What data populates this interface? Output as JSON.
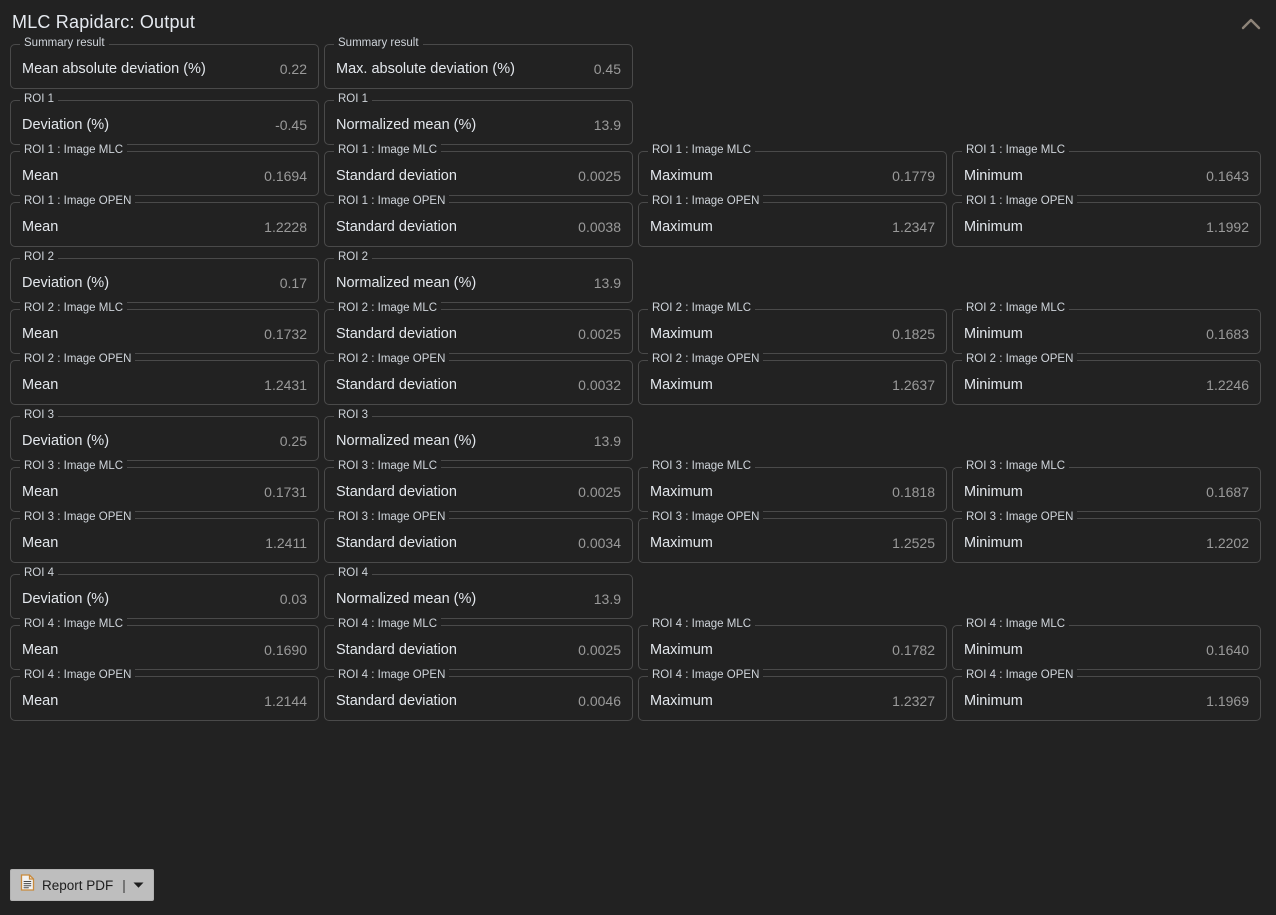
{
  "header": {
    "title": "MLC Rapidarc: Output",
    "collapse_icon": "chevron-up-icon"
  },
  "footer": {
    "report_button_label": "Report PDF",
    "report_button_icon": "document-icon",
    "separator": "|",
    "dropdown_icon": "caret-down-icon"
  },
  "colors": {
    "background": "#222222",
    "card_border": "#4a4a4a",
    "label_text": "#e3e7ec",
    "value_text": "#9a9a9a",
    "legend_text": "#cfd4da",
    "button_face": "#bebebe",
    "button_text": "#1d1d1d",
    "accent_icon": "#c98a3c"
  },
  "rows": [
    {
      "gap": true,
      "cells": [
        {
          "legend": "Summary result",
          "label": "Mean absolute deviation (%)",
          "value": "0.22"
        },
        {
          "legend": "Summary result",
          "label": "Max. absolute deviation (%)",
          "value": "0.45"
        },
        null,
        null
      ]
    },
    {
      "gap": false,
      "cells": [
        {
          "legend": "ROI 1",
          "label": "Deviation (%)",
          "value": "-0.45"
        },
        {
          "legend": "ROI 1",
          "label": "Normalized mean (%)",
          "value": "13.9"
        },
        null,
        null
      ]
    },
    {
      "gap": false,
      "cells": [
        {
          "legend": "ROI 1 : Image MLC",
          "label": "Mean",
          "value": "0.1694"
        },
        {
          "legend": "ROI 1 : Image MLC",
          "label": "Standard deviation",
          "value": "0.0025"
        },
        {
          "legend": "ROI 1 : Image MLC",
          "label": "Maximum",
          "value": "0.1779"
        },
        {
          "legend": "ROI 1 : Image MLC",
          "label": "Minimum",
          "value": "0.1643"
        }
      ]
    },
    {
      "gap": true,
      "cells": [
        {
          "legend": "ROI 1 : Image OPEN",
          "label": "Mean",
          "value": "1.2228"
        },
        {
          "legend": "ROI 1 : Image OPEN",
          "label": "Standard deviation",
          "value": "0.0038"
        },
        {
          "legend": "ROI 1 : Image OPEN",
          "label": "Maximum",
          "value": "1.2347"
        },
        {
          "legend": "ROI 1 : Image OPEN",
          "label": "Minimum",
          "value": "1.1992"
        }
      ]
    },
    {
      "gap": false,
      "cells": [
        {
          "legend": "ROI 2",
          "label": "Deviation (%)",
          "value": "0.17"
        },
        {
          "legend": "ROI 2",
          "label": "Normalized mean (%)",
          "value": "13.9"
        },
        null,
        null
      ]
    },
    {
      "gap": false,
      "cells": [
        {
          "legend": "ROI 2 : Image MLC",
          "label": "Mean",
          "value": "0.1732"
        },
        {
          "legend": "ROI 2 : Image MLC",
          "label": "Standard deviation",
          "value": "0.0025"
        },
        {
          "legend": "ROI 2 : Image MLC",
          "label": "Maximum",
          "value": "0.1825"
        },
        {
          "legend": "ROI 2 : Image MLC",
          "label": "Minimum",
          "value": "0.1683"
        }
      ]
    },
    {
      "gap": true,
      "cells": [
        {
          "legend": "ROI 2 : Image OPEN",
          "label": "Mean",
          "value": "1.2431"
        },
        {
          "legend": "ROI 2 : Image OPEN",
          "label": "Standard deviation",
          "value": "0.0032"
        },
        {
          "legend": "ROI 2 : Image OPEN",
          "label": "Maximum",
          "value": "1.2637"
        },
        {
          "legend": "ROI 2 : Image OPEN",
          "label": "Minimum",
          "value": "1.2246"
        }
      ]
    },
    {
      "gap": false,
      "cells": [
        {
          "legend": "ROI 3",
          "label": "Deviation (%)",
          "value": "0.25"
        },
        {
          "legend": "ROI 3",
          "label": "Normalized mean (%)",
          "value": "13.9"
        },
        null,
        null
      ]
    },
    {
      "gap": false,
      "cells": [
        {
          "legend": "ROI 3 : Image MLC",
          "label": "Mean",
          "value": "0.1731"
        },
        {
          "legend": "ROI 3 : Image MLC",
          "label": "Standard deviation",
          "value": "0.0025"
        },
        {
          "legend": "ROI 3 : Image MLC",
          "label": "Maximum",
          "value": "0.1818"
        },
        {
          "legend": "ROI 3 : Image MLC",
          "label": "Minimum",
          "value": "0.1687"
        }
      ]
    },
    {
      "gap": true,
      "cells": [
        {
          "legend": "ROI 3 : Image OPEN",
          "label": "Mean",
          "value": "1.2411"
        },
        {
          "legend": "ROI 3 : Image OPEN",
          "label": "Standard deviation",
          "value": "0.0034"
        },
        {
          "legend": "ROI 3 : Image OPEN",
          "label": "Maximum",
          "value": "1.2525"
        },
        {
          "legend": "ROI 3 : Image OPEN",
          "label": "Minimum",
          "value": "1.2202"
        }
      ]
    },
    {
      "gap": false,
      "cells": [
        {
          "legend": "ROI 4",
          "label": "Deviation (%)",
          "value": "0.03"
        },
        {
          "legend": "ROI 4",
          "label": "Normalized mean (%)",
          "value": "13.9"
        },
        null,
        null
      ]
    },
    {
      "gap": false,
      "cells": [
        {
          "legend": "ROI 4 : Image MLC",
          "label": "Mean",
          "value": "0.1690"
        },
        {
          "legend": "ROI 4 : Image MLC",
          "label": "Standard deviation",
          "value": "0.0025"
        },
        {
          "legend": "ROI 4 : Image MLC",
          "label": "Maximum",
          "value": "0.1782"
        },
        {
          "legend": "ROI 4 : Image MLC",
          "label": "Minimum",
          "value": "0.1640"
        }
      ]
    },
    {
      "gap": false,
      "cells": [
        {
          "legend": "ROI 4 : Image OPEN",
          "label": "Mean",
          "value": "1.2144"
        },
        {
          "legend": "ROI 4 : Image OPEN",
          "label": "Standard deviation",
          "value": "0.0046"
        },
        {
          "legend": "ROI 4 : Image OPEN",
          "label": "Maximum",
          "value": "1.2327"
        },
        {
          "legend": "ROI 4 : Image OPEN",
          "label": "Minimum",
          "value": "1.1969"
        }
      ]
    }
  ]
}
